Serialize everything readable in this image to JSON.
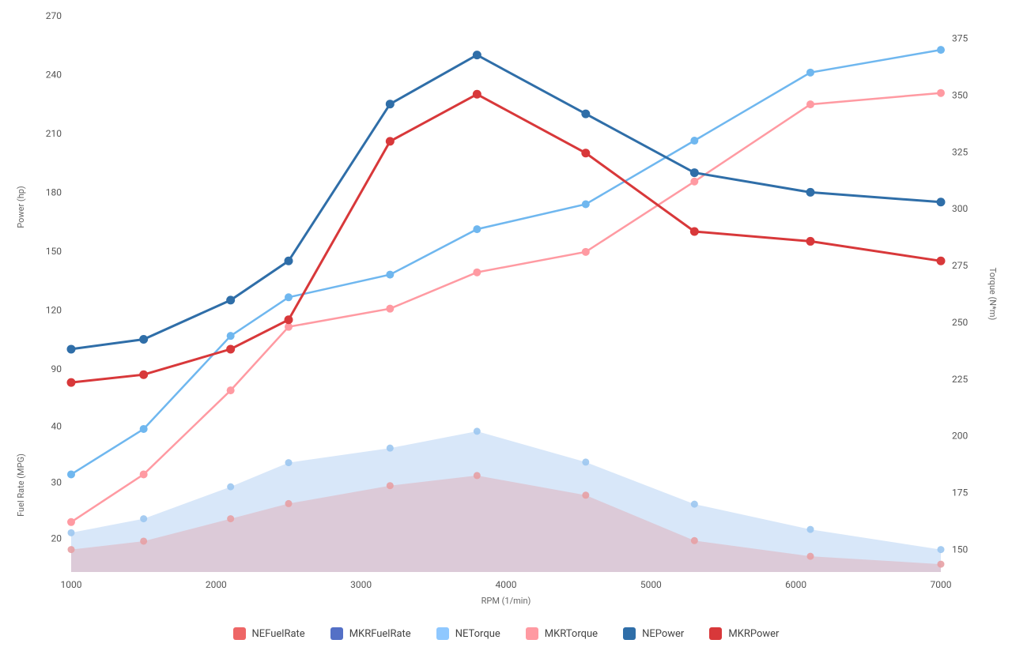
{
  "chart_data": {
    "type": "line",
    "x": [
      1000,
      1500,
      2100,
      2500,
      3200,
      3800,
      4550,
      5300,
      6100,
      7000
    ],
    "xlabel": "RPM (1/min)",
    "left_axis": {
      "label_top": "Power (hp)",
      "label_bottom": "Fuel Rate (MPG)",
      "ticks_top": [
        90,
        120,
        150,
        180,
        210,
        240,
        270
      ],
      "ticks_bottom": [
        20,
        30,
        40
      ],
      "scale_notes": "Upper section plots Power (hp) roughly 80-270; lower inset plots Fuel Rate (MPG) roughly 15-45"
    },
    "right_axis": {
      "label": "Torque (N*m)",
      "ticks": [
        150,
        175,
        200,
        225,
        250,
        275,
        300,
        325,
        350,
        375
      ]
    },
    "series": [
      {
        "name": "NEFuelRate",
        "color": "#ee6666",
        "style": "area",
        "axis": "fuel",
        "values": [
          18.0,
          19.5,
          23.5,
          26.2,
          29.4,
          31.2,
          27.7,
          19.6,
          16.8,
          15.4
        ]
      },
      {
        "name": "MKRFuelRate",
        "color": "#5470c6",
        "style": "area",
        "axis": "fuel",
        "values": [
          21.0,
          23.5,
          29.2,
          33.5,
          36.1,
          39.1,
          33.6,
          26.1,
          21.6,
          18.0
        ]
      },
      {
        "name": "NETorque",
        "color": "#91cc75",
        "display_color": "#8fc8ff",
        "style": "line",
        "axis": "torque",
        "values": [
          183,
          203,
          244,
          261,
          271,
          291,
          302,
          330,
          360,
          370
        ]
      },
      {
        "name": "MKRTorque",
        "color": "#fc8452",
        "display_color": "#ff9aa2",
        "style": "line",
        "axis": "torque",
        "values": [
          162,
          183,
          220,
          248,
          256,
          272,
          281,
          312,
          346,
          351
        ]
      },
      {
        "name": "NEPower",
        "color": "#3ba272",
        "display_color": "#2f6ea8",
        "style": "line",
        "axis": "power",
        "values": [
          100,
          105,
          125,
          145,
          225,
          250,
          220,
          190,
          180,
          175
        ]
      },
      {
        "name": "MKRPower",
        "color": "#fac858",
        "display_color": "#d8383a",
        "style": "line",
        "axis": "power",
        "values": [
          83,
          87,
          100,
          115,
          206,
          230,
          200,
          160,
          155,
          145
        ]
      }
    ],
    "legend_labels": [
      "NEFuelRate",
      "MKRFuelRate",
      "NETorque",
      "MKRTorque",
      "NEPower",
      "MKRPower"
    ],
    "legend_colors": [
      "#ee6666",
      "#5470c6",
      "#8fc8ff",
      "#ff9aa2",
      "#2f6ea8",
      "#d8383a"
    ],
    "x_ticks": [
      1000,
      2000,
      3000,
      4000,
      5000,
      6000,
      7000
    ]
  }
}
